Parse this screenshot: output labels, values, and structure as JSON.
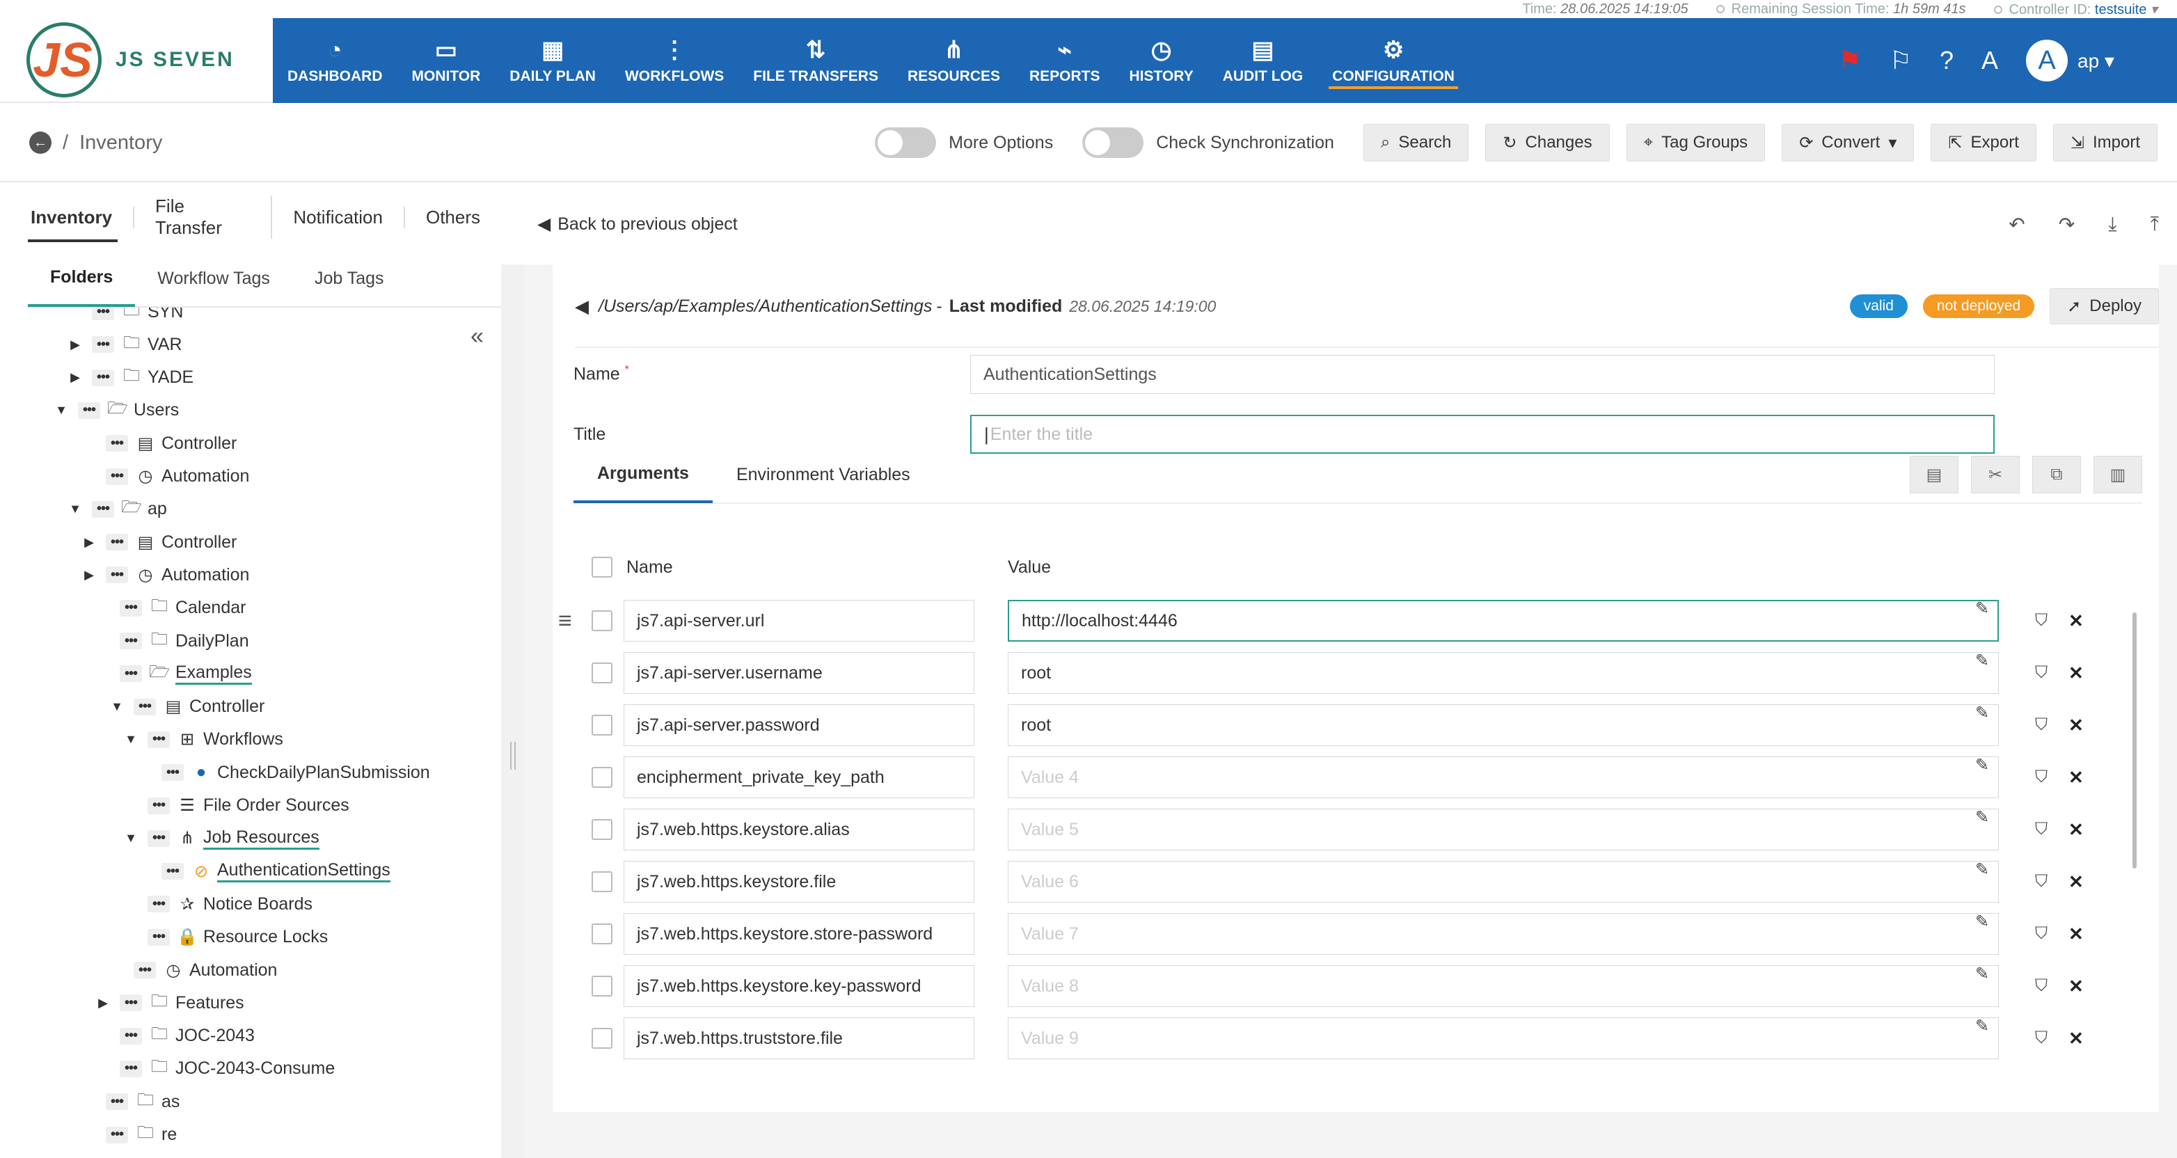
{
  "topinfo": {
    "time_label": "Time:",
    "time": "28.06.2025 14:19:05",
    "session_label": "Remaining Session Time:",
    "session": "1h 59m 41s",
    "controller_label": "Controller ID:",
    "controller": "testsuite"
  },
  "brand": {
    "mark": "JS",
    "name": "JS SEVEN"
  },
  "nav": [
    {
      "label": "DASHBOARD",
      "icon": "dashboard-icon",
      "glyph": "◔"
    },
    {
      "label": "MONITOR",
      "icon": "monitor-icon",
      "glyph": "▭"
    },
    {
      "label": "DAILY PLAN",
      "icon": "calendar-clock-icon",
      "glyph": "▦"
    },
    {
      "label": "WORKFLOWS",
      "icon": "workflow-icon",
      "glyph": "⋮"
    },
    {
      "label": "FILE TRANSFERS",
      "icon": "transfer-icon",
      "glyph": "⇅"
    },
    {
      "label": "RESOURCES",
      "icon": "share-icon",
      "glyph": "⋔"
    },
    {
      "label": "REPORTS",
      "icon": "chart-icon",
      "glyph": "⌁"
    },
    {
      "label": "HISTORY",
      "icon": "alarm-clock-icon",
      "glyph": "◷"
    },
    {
      "label": "AUDIT LOG",
      "icon": "file-search-icon",
      "glyph": "▤"
    },
    {
      "label": "CONFIGURATION",
      "icon": "gear-icon",
      "glyph": "⚙"
    }
  ],
  "user": {
    "initial": "A",
    "name": "ap"
  },
  "breadcrumb": {
    "title": "Inventory"
  },
  "toolbar": {
    "more_options": "More Options",
    "check_sync": "Check Synchronization",
    "search": "Search",
    "changes": "Changes",
    "tag_groups": "Tag Groups",
    "convert": "Convert",
    "export": "Export",
    "import": "Import"
  },
  "left_tabs": [
    "Inventory",
    "File Transfer",
    "Notification",
    "Others"
  ],
  "sub_tabs": [
    "Folders",
    "Workflow Tags",
    "Job Tags"
  ],
  "tree": [
    {
      "label": "SYN",
      "depth": 1,
      "caret": "",
      "icon": "folder"
    },
    {
      "label": "VAR",
      "depth": 1,
      "caret": "▶",
      "icon": "folder"
    },
    {
      "label": "YADE",
      "depth": 1,
      "caret": "▶",
      "icon": "folder"
    },
    {
      "label": "Users",
      "depth": 0,
      "caret": "▼",
      "icon": "folder-open"
    },
    {
      "label": "Controller",
      "depth": 2,
      "caret": "",
      "icon": "controller"
    },
    {
      "label": "Automation",
      "depth": 2,
      "caret": "",
      "icon": "automation"
    },
    {
      "label": "ap",
      "depth": 1,
      "caret": "▼",
      "icon": "folder-open"
    },
    {
      "label": "Controller",
      "depth": 2,
      "caret": "▶",
      "icon": "controller"
    },
    {
      "label": "Automation",
      "depth": 2,
      "caret": "▶",
      "icon": "automation"
    },
    {
      "label": "Calendar",
      "depth": 3,
      "caret": "",
      "icon": "folder"
    },
    {
      "label": "DailyPlan",
      "depth": 3,
      "caret": "",
      "icon": "folder"
    },
    {
      "label": "Examples",
      "depth": 3,
      "caret": "",
      "icon": "folder-open",
      "underline": true
    },
    {
      "label": "Controller",
      "depth": 4,
      "caret": "▼",
      "icon": "controller"
    },
    {
      "label": "Workflows",
      "depth": 5,
      "caret": "▼",
      "icon": "workflow"
    },
    {
      "label": "CheckDailyPlanSubmission",
      "depth": 6,
      "caret": "",
      "icon": "dot-blue"
    },
    {
      "label": "File Order Sources",
      "depth": 5,
      "caret": "",
      "icon": "list"
    },
    {
      "label": "Job Resources",
      "depth": 5,
      "caret": "▼",
      "icon": "share",
      "underline": true
    },
    {
      "label": "AuthenticationSettings",
      "depth": 6,
      "caret": "",
      "icon": "dot-orange",
      "underline": true
    },
    {
      "label": "Notice Boards",
      "depth": 5,
      "caret": "",
      "icon": "pin"
    },
    {
      "label": "Resource Locks",
      "depth": 5,
      "caret": "",
      "icon": "lock"
    },
    {
      "label": "Automation",
      "depth": 4,
      "caret": "",
      "icon": "automation"
    },
    {
      "label": "Features",
      "depth": 3,
      "caret": "▶",
      "icon": "folder"
    },
    {
      "label": "JOC-2043",
      "depth": 3,
      "caret": "",
      "icon": "folder"
    },
    {
      "label": "JOC-2043-Consume",
      "depth": 3,
      "caret": "",
      "icon": "folder"
    },
    {
      "label": "as",
      "depth": 2,
      "caret": "",
      "icon": "folder"
    },
    {
      "label": "re",
      "depth": 2,
      "caret": "",
      "icon": "folder"
    }
  ],
  "main": {
    "back_label": "Back to previous object",
    "path": "/Users/ap/Examples/AuthenticationSettings",
    "last_modified_label": "Last modified",
    "last_modified": "28.06.2025 14:19:00",
    "badge_valid": "valid",
    "badge_state": "not deployed",
    "deploy": "Deploy",
    "name_label": "Name",
    "name_value": "AuthenticationSettings",
    "title_label": "Title",
    "title_placeholder": "Enter the title",
    "tab_arguments": "Arguments",
    "tab_env": "Environment Variables",
    "col_name": "Name",
    "col_value": "Value"
  },
  "arguments": [
    {
      "name": "js7.api-server.url",
      "value": "http://localhost:4446",
      "placeholder": false
    },
    {
      "name": "js7.api-server.username",
      "value": "root",
      "placeholder": false
    },
    {
      "name": "js7.api-server.password",
      "value": "root",
      "placeholder": false
    },
    {
      "name": "encipherment_private_key_path",
      "value": "Value 4",
      "placeholder": true
    },
    {
      "name": "js7.web.https.keystore.alias",
      "value": "Value 5",
      "placeholder": true
    },
    {
      "name": "js7.web.https.keystore.file",
      "value": "Value 6",
      "placeholder": true
    },
    {
      "name": "js7.web.https.keystore.store-password",
      "value": "Value 7",
      "placeholder": true
    },
    {
      "name": "js7.web.https.keystore.key-password",
      "value": "Value 8",
      "placeholder": true
    },
    {
      "name": "js7.web.https.truststore.file",
      "value": "Value 9",
      "placeholder": true
    }
  ],
  "colors": {
    "nav": "#1d66b3",
    "accent": "#2a9d8f",
    "valid": "#1f8fd6",
    "not_deployed": "#f59a23"
  }
}
